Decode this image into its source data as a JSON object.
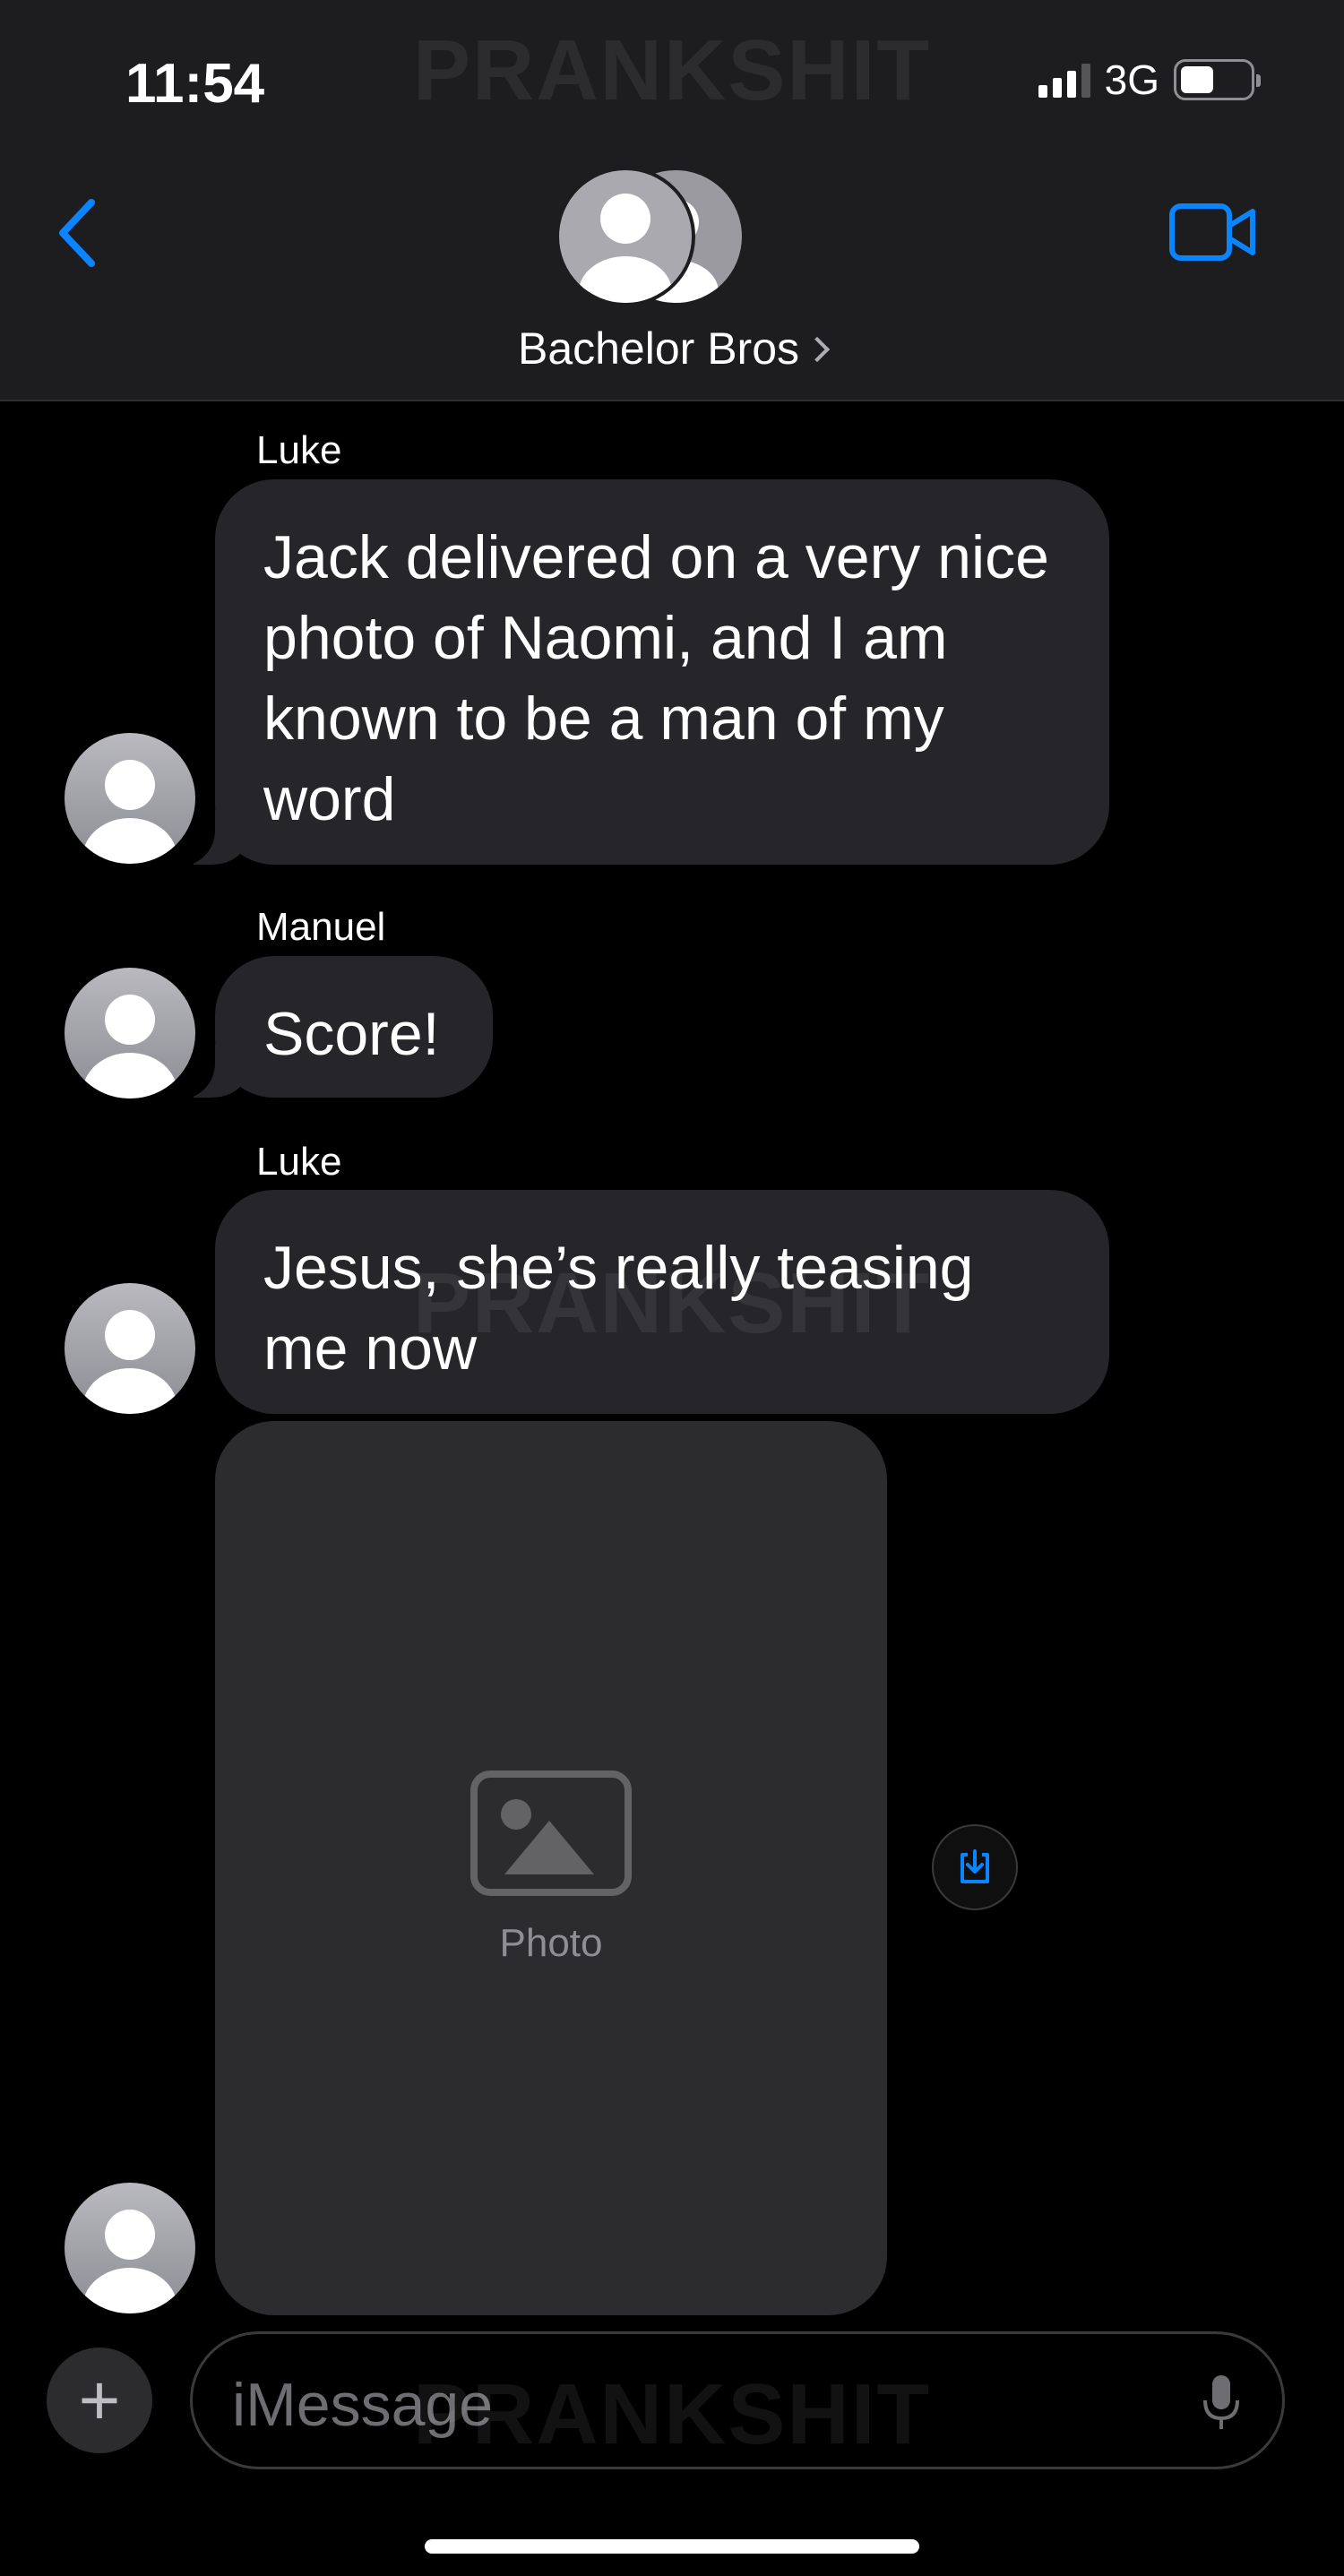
{
  "status": {
    "time": "11:54",
    "network": "3G",
    "battery_level": 0.55
  },
  "header": {
    "group_name": "Bachelor Bros"
  },
  "watermark": "PRANKSHIT",
  "messages": [
    {
      "sender": "Luke",
      "text": "Jack delivered on a very nice photo of Naomi, and I am known to be a man of my word"
    },
    {
      "sender": "Manuel",
      "text": "Score!"
    },
    {
      "sender": "Luke",
      "text": "Jesus, she’s really teasing me now"
    }
  ],
  "attachment": {
    "type": "photo",
    "placeholder": "Photo"
  },
  "input": {
    "placeholder": "iMessage"
  },
  "colors": {
    "accent": "#0a84ff",
    "bubble": "#26262a",
    "header": "#1d1d1f"
  },
  "icons": [
    "back-chevron-icon",
    "video-camera-icon",
    "group-avatar-icon",
    "save-download-icon",
    "plus-icon",
    "microphone-icon"
  ]
}
